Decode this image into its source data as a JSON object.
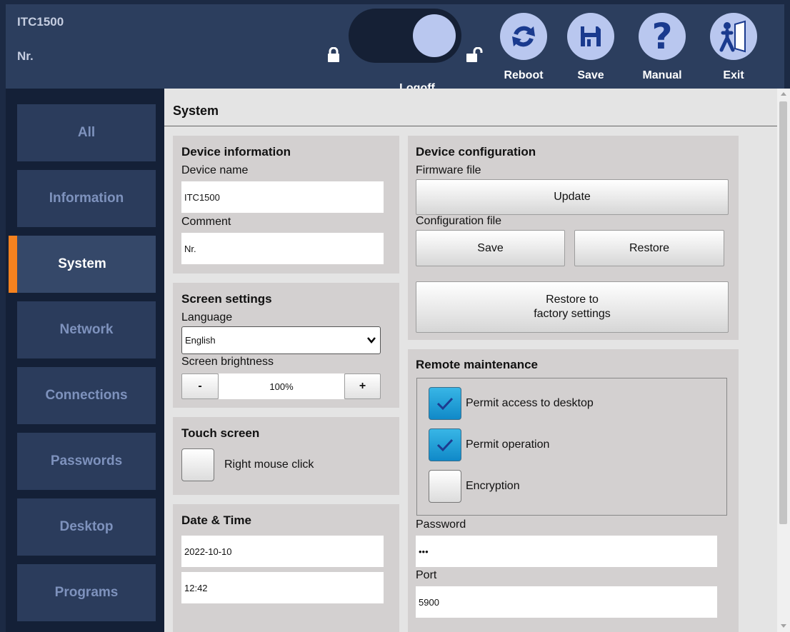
{
  "header": {
    "device_title": "ITC1500",
    "device_subtitle": "Nr.",
    "logoff_label": "Logoff",
    "reboot_label": "Reboot",
    "save_label": "Save",
    "manual_label": "Manual",
    "exit_label": "Exit"
  },
  "sidebar": {
    "items": [
      {
        "label": "All"
      },
      {
        "label": "Information"
      },
      {
        "label": "System"
      },
      {
        "label": "Network"
      },
      {
        "label": "Connections"
      },
      {
        "label": "Passwords"
      },
      {
        "label": "Desktop"
      },
      {
        "label": "Programs"
      }
    ],
    "active": "System"
  },
  "page": {
    "title": "System"
  },
  "device_information": {
    "title": "Device information",
    "name_label": "Device name",
    "name_value": "ITC1500",
    "comment_label": "Comment",
    "comment_value": "Nr."
  },
  "screen_settings": {
    "title": "Screen settings",
    "language_label": "Language",
    "language_value": "English",
    "brightness_label": "Screen brightness",
    "brightness_value": "100%",
    "minus": "-",
    "plus": "+"
  },
  "touch_screen": {
    "title": "Touch screen",
    "right_click_label": "Right mouse click",
    "right_click_checked": false
  },
  "date_time": {
    "title": "Date & Time",
    "date": "2022-10-10",
    "time": "12:42"
  },
  "device_configuration": {
    "title": "Device configuration",
    "firmware_label": "Firmware file",
    "update_label": "Update",
    "config_label": "Configuration file",
    "save_label": "Save",
    "restore_label": "Restore",
    "factory_line1": "Restore to",
    "factory_line2": "factory settings"
  },
  "remote_maintenance": {
    "title": "Remote maintenance",
    "permit_desktop_label": "Permit access to desktop",
    "permit_desktop_checked": true,
    "permit_operation_label": "Permit operation",
    "permit_operation_checked": true,
    "encryption_label": "Encryption",
    "encryption_checked": false,
    "password_label": "Password",
    "password_value": "•••",
    "port_label": "Port",
    "port_value": "5900"
  },
  "colors": {
    "header_bg": "#2c3e5e",
    "sidebar_bg": "#142037",
    "active_accent": "#f5821f",
    "button_circle": "#b9c7ef",
    "checkbox_checked": "#1a9ad6"
  }
}
